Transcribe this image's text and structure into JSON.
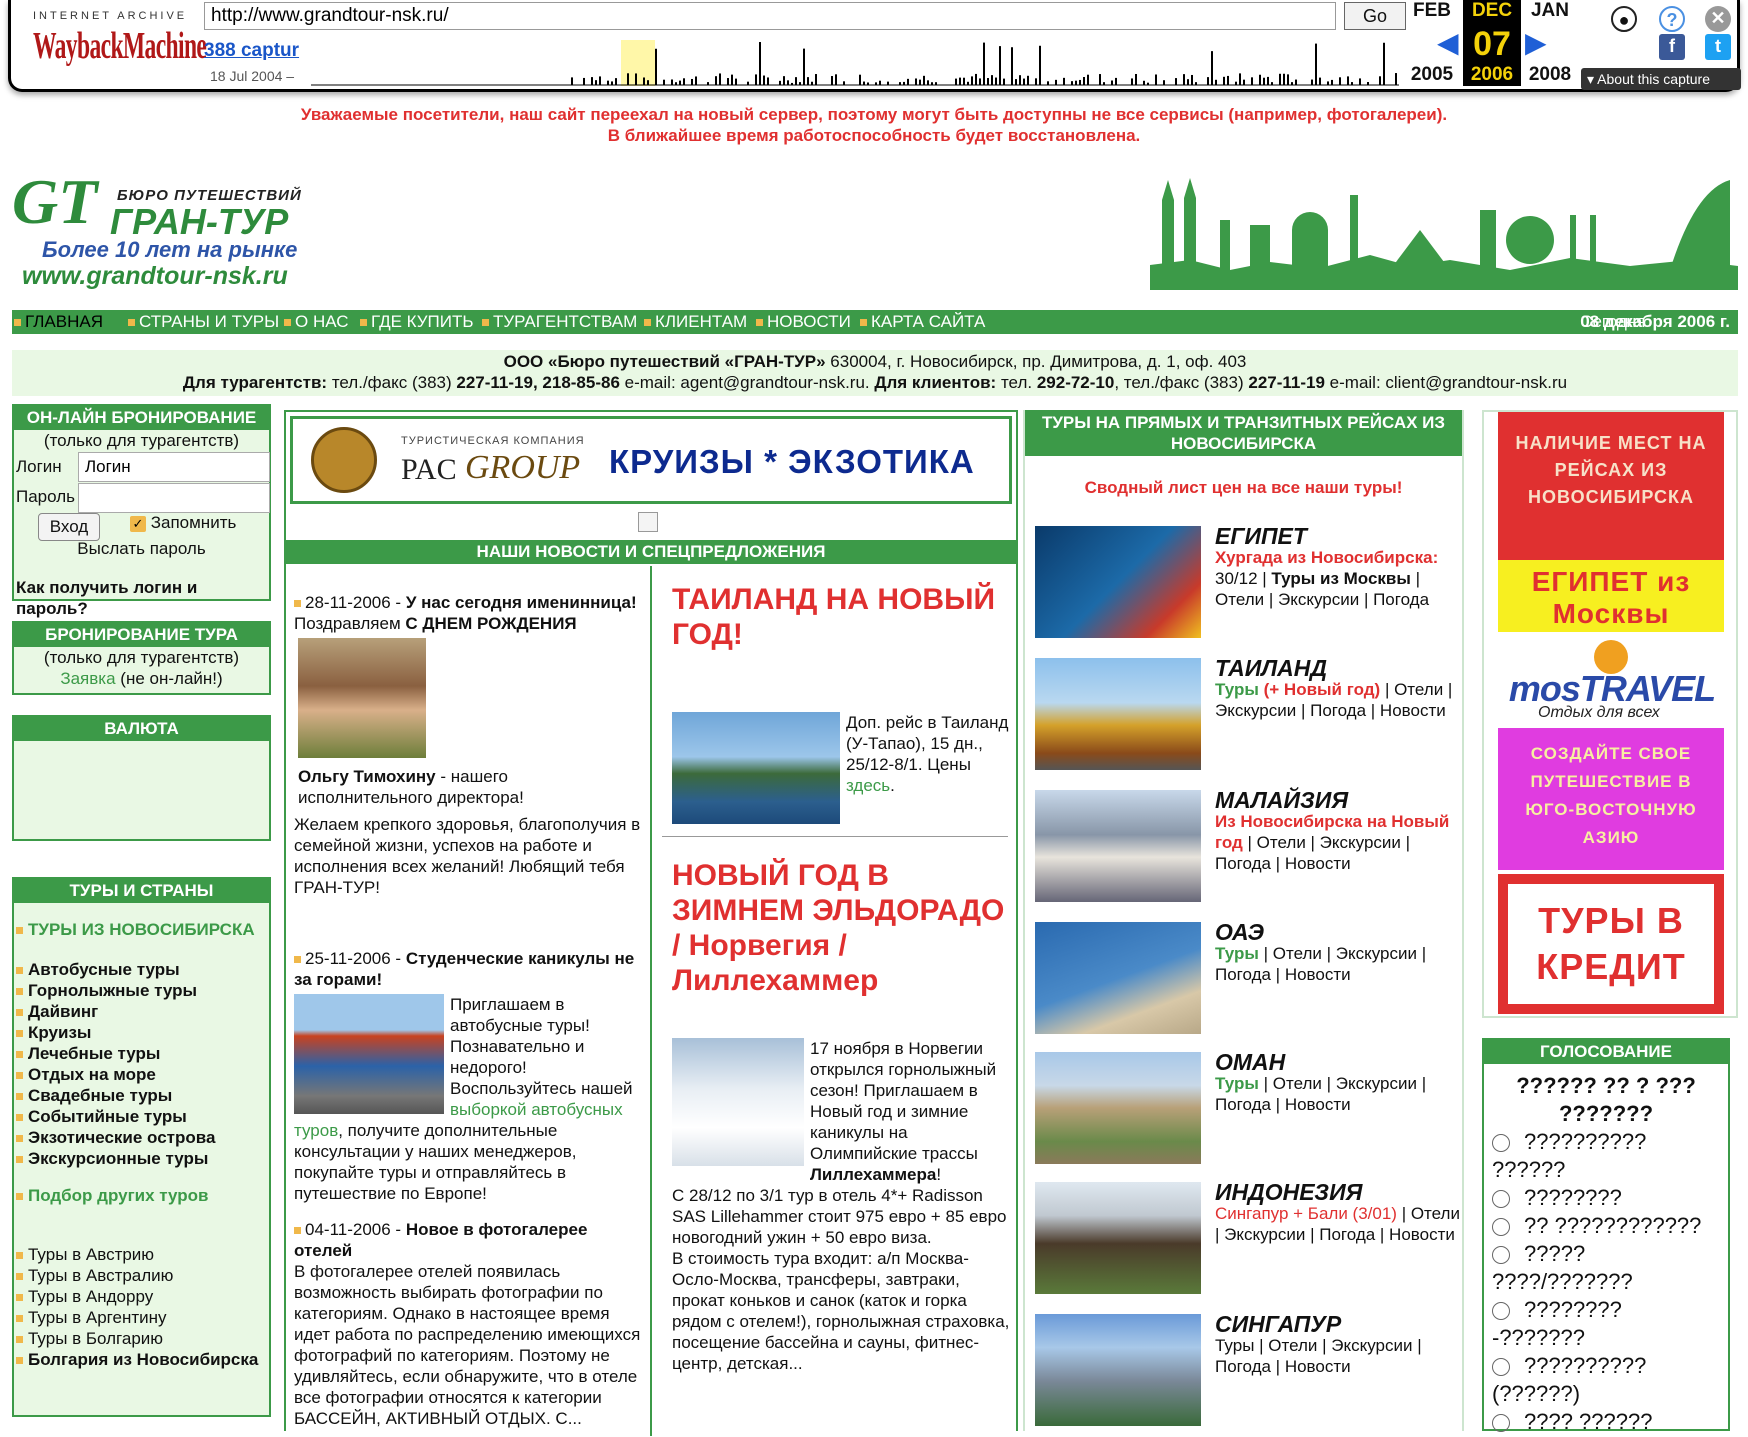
{
  "wayback": {
    "logo_top": "INTERNET ARCHIVE",
    "logo": "WaybackMachine",
    "url": "http://www.grandtour-nsk.ru/",
    "go": "Go",
    "captures": "388 captur",
    "date_range": "18 Jul 2004 –",
    "prev_month": "FEB",
    "prev_year": "2005",
    "cur_month": "DEC",
    "cur_day": "07",
    "cur_year": "2006",
    "next_month": "JAN",
    "next_year": "2008",
    "about": "About this capture"
  },
  "notice": {
    "line1": "Уважаемые посетители, наш сайт переехал на новый сервер, поэтому могут быть доступны не все сервисы (например, фотогалереи).",
    "line2": "В ближайшее время работоспособность будет восстановлена."
  },
  "logo": {
    "gt": "GT",
    "bureau": "БЮРО ПУТЕШЕСТВИЙ",
    "name": "ГРАН-ТУР",
    "years": "Более 10 лет на рынке",
    "site": "www.grandtour-nsk.ru"
  },
  "nav": {
    "items": [
      "ГЛАВНАЯ",
      "СТРАНЫ И ТУРЫ",
      "О НАС",
      "ГДЕ КУПИТЬ",
      "ТУРАГЕНТСТВАМ",
      "КЛИЕНТАМ",
      "НОВОСТИ",
      "КАРТА САЙТА"
    ],
    "today_label": "Сегодня",
    "today_date": "08 декабря 2006 г."
  },
  "contact": {
    "company": "ООО «Бюро путешествий «ГРАН-ТУР»",
    "address": "630004, г. Новосибирск, пр. Димитрова, д. 1, оф. 403",
    "agents_label": "Для турагентств:",
    "agents_phone_pre": "тел./факс (383)",
    "agents_phone": "227-11-19, 218-85-86",
    "agents_email": "e-mail: agent@grandtour-nsk.ru.",
    "clients_label": "Для клиентов:",
    "clients_phone_pre": "тел.",
    "clients_phone": "292-72-10",
    "clients_fax_pre": ", тел./факс (383)",
    "clients_fax": "227-11-19",
    "clients_email": "e-mail: client@grandtour-nsk.ru"
  },
  "login": {
    "title": "ОН-ЛАЙН БРОНИРОВАНИЕ",
    "sub": "(только для турагентств)",
    "login_label": "Логин",
    "login_value": "Логин",
    "pass_label": "Пароль",
    "enter": "Вход",
    "remember": "Запомнить",
    "send_pass": "Выслать пароль",
    "how": "Как получить логин и пароль?"
  },
  "booking": {
    "title": "БРОНИРОВАНИЕ ТУРА",
    "sub": "(только для турагентств)",
    "link": "Заявка",
    "note": "(не он-лайн!)"
  },
  "currency": {
    "title": "ВАЛЮТА"
  },
  "tours": {
    "title": "ТУРЫ И СТРАНЫ",
    "from_nsk": "ТУРЫ ИЗ НОВОСИБИРСКА",
    "types": [
      "Автобусные туры",
      "Горнолыжные туры",
      "Дайвинг",
      "Круизы",
      "Лечебные туры",
      "Отдых на море",
      "Свадебные туры",
      "Событийные туры",
      "Экзотические острова",
      "Экскурсионные туры"
    ],
    "other": "Подбор других туров",
    "countries": [
      "Туры в Австрию",
      "Туры в Австралию",
      "Туры в Андорру",
      "Туры в Аргентину",
      "Туры в Болгарию"
    ],
    "bulgaria": "Болгария из Новосибирска"
  },
  "banner": {
    "small": "ТУРИСТИЧЕСКАЯ КОМПАНИЯ",
    "pac": "PAC",
    "group": "GROUP",
    "text": "КРУИЗЫ * ЭКЗОТИКА"
  },
  "news": {
    "title": "НАШИ НОВОСТИ И СПЕЦПРЕДЛОЖЕНИЯ",
    "n1_date": "28-11-2006",
    "n1_title": "У нас сегодня именинница!",
    "n1_l1": "Поздравляем",
    "n1_l1b": "С ДНЕМ РОЖДЕНИЯ",
    "n1_name": "Ольгу Тимохину",
    "n1_role": "- нашего исполнительного директора!",
    "n1_body": "Желаем крепкого здоровья, благополучия в семейной жизни, успехов на работе и исполнения всех желаний! Любящий тебя ГРАН-ТУР!",
    "n2_date": "25-11-2006",
    "n2_title": "Студенческие каникулы не за горами!",
    "n2_body1": "Приглашаем в автобусные туры! Познавательно и недорого! Воспользуйтесь нашей",
    "n2_link": "выборкой автобусных туров",
    "n2_body2": ", получите дополнительные консультации у наших менеджеров, покупайте туры и отправляйтесь в путешествие по Европе!",
    "n3_date": "04-11-2006",
    "n3_title": "Новое в фотогалерее отелей",
    "n3_body": "В фотогалерее отелей появилась возможность выбирать фотографии по категориям. Однако в настоящее время идет работа по распределению имеющихся фотографий по категориям. Поэтому не удивляйтесь, если обнаружите, что в отеле все фотографии относятся к категории БАССЕЙН, АКТИВНЫЙ ОТДЫХ. С..."
  },
  "specials": {
    "s1_title": "ТАИЛАНД НА НОВЫЙ ГОД!",
    "s1_body": "Доп. рейс в Таиланд (У-Тапао), 15 дн., 25/12-8/1. Цены",
    "s1_link": "здесь",
    "s2_title": "НОВЫЙ ГОД В ЗИМНЕМ ЭЛЬДОРАДО / Норвегия / Лиллехаммер",
    "s2_body1": "17 ноября в Норвегии открылся горнолыжный сезон! Приглашаем в Новый год и зимние каникулы на Олимпийские трассы",
    "s2_bold": "Лиллехаммера",
    "s2_body2": "С 28/12 по 3/1 тур в отель 4*+ Radisson SAS Lillehammer стоит 975 евро + 85 евро новогодний ужин + 50 евро виза.",
    "s2_body3": "В стоимость тура входит: а/п Москва-Осло-Москва, трансферы, завтраки, прокат коньков и санок (каток и горка рядом с отелем!), горнолыжная страховка, посещение бассейна и сауны, фитнес-центр, детская..."
  },
  "direct": {
    "title": "ТУРЫ НА ПРЯМЫХ И ТРАНЗИТНЫХ РЕЙСАХ ИЗ НОВОСИБИРСКА",
    "summary": "Сводный лист цен на все наши туры!",
    "tours": [
      {
        "country": "ЕГИПЕТ",
        "red": "Хургада из Новосибирска:",
        "rest": "30/12 |",
        "bold": "Туры из Москвы",
        "links": "| Отели | Экскурсии | Погода"
      },
      {
        "country": "ТАИЛАНД",
        "green": "Туры",
        "red": "(+ Новый год)",
        "links": "| Отели | Экскурсии | Погода | Новости"
      },
      {
        "country": "МАЛАЙЗИЯ",
        "red": "Из Новосибирска на Новый год",
        "links": "| Отели | Экскурсии | Погода | Новости"
      },
      {
        "country": "ОАЭ",
        "green": "Туры",
        "links": "| Отели | Экскурсии | Погода | Новости"
      },
      {
        "country": "ОМАН",
        "green": "Туры",
        "links": "| Отели | Экскурсии | Погода | Новости"
      },
      {
        "country": "ИНДОНЕЗИЯ",
        "red": "Сингапур + Бали (3/01)",
        "links": "| Отели | Экскурсии | Погода | Новости"
      },
      {
        "country": "СИНГАПУР",
        "links": "Туры | Отели | Экскурсии | Погода | Новости"
      }
    ]
  },
  "ads": {
    "a1": "НАЛИЧИЕ МЕСТ НА РЕЙСАХ ИЗ НОВОСИБИРСКА",
    "a2": "ЕГИПЕТ из Москвы",
    "a3": "mosTRAVEL",
    "a3_sub": "Отдых для всех",
    "a4": "СОЗДАЙТЕ СВОЕ ПУТЕШЕСТВИЕ В ЮГО-ВОСТОЧНУЮ АЗИЮ",
    "a5": "ТУРЫ В КРЕДИТ"
  },
  "vote": {
    "title": "ГОЛОСОВАНИЕ",
    "question": "?????? ?? ? ??? ???????",
    "options": [
      "??????????",
      "??????",
      "????????",
      "?? ????????????",
      "?????",
      "????/???????",
      "????????",
      "-???????",
      "??????????",
      "(??????)",
      "???? ??????"
    ]
  },
  "colors": {
    "green": "#3c9a48",
    "light": "#e9f8e4",
    "red": "#e03030",
    "accent": "#f0b84a"
  }
}
